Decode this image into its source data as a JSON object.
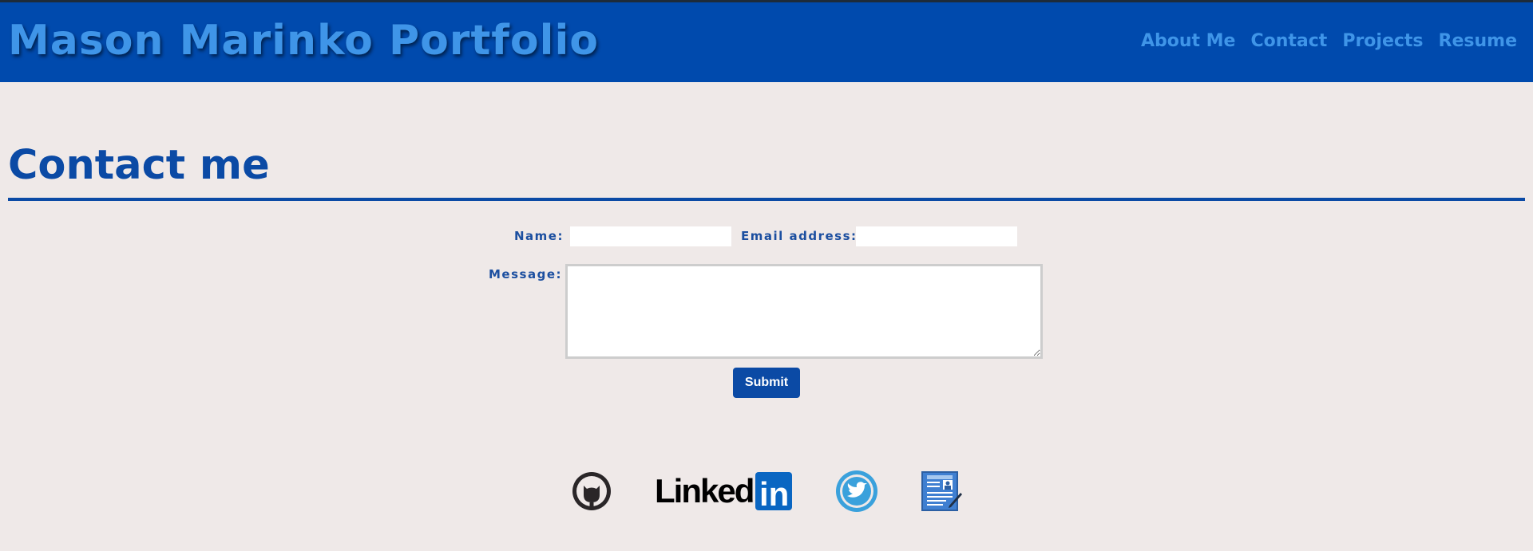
{
  "header": {
    "title": "Mason Marinko Portfolio",
    "nav": [
      {
        "label": "About Me"
      },
      {
        "label": "Contact"
      },
      {
        "label": "Projects"
      },
      {
        "label": "Resume"
      }
    ]
  },
  "main": {
    "heading": "Contact me",
    "form": {
      "name_label": "Name:",
      "name_value": "",
      "email_label": "Email address:",
      "email_value": "",
      "message_label": "Message:",
      "message_value": "",
      "submit_label": "Submit"
    }
  },
  "social": {
    "icons": [
      "github-icon",
      "linkedin-icon",
      "twitter-icon",
      "resume-icon"
    ],
    "linkedin_text": "Linked",
    "linkedin_box_text": "in"
  },
  "colors": {
    "header_bg": "#004aad",
    "title_color": "#3f95e8",
    "heading_color": "#0b4aa5",
    "page_bg": "#efe9e8"
  }
}
